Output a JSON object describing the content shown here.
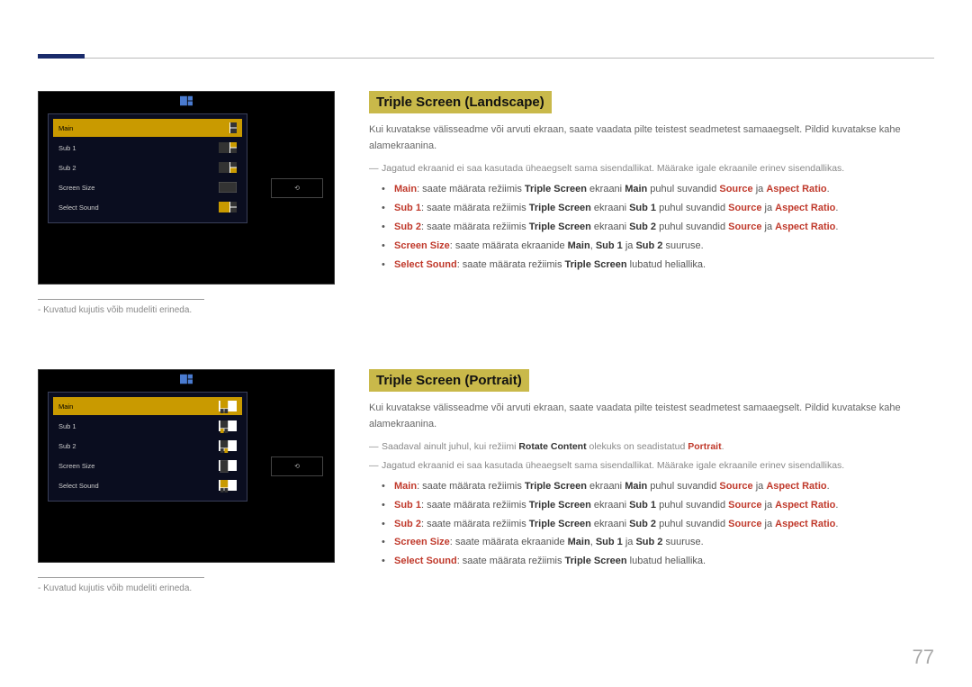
{
  "page_number": "77",
  "caption": "Kuvatud kujutis võib mudeliti erineda.",
  "mock_side_label": "⟲",
  "sections": [
    {
      "title": "Triple Screen (Landscape)",
      "desc": "Kui kuvatakse välisseadme või arvuti ekraan, saate vaadata pilte teistest seadmetest samaaegselt. Pildid kuvatakse kahe alamekraanina.",
      "notes": [
        "Jagatud ekraanid ei saa kasutada üheaegselt sama sisendallikat. Määrake igale ekraanile erinev sisendallikas."
      ],
      "bullets": [
        {
          "lead": "Main",
          "t1": ": saate määrata režiimis ",
          "b1": "Triple Screen",
          "t2": " ekraani ",
          "b2": "Main",
          "t3": " puhul suvandid ",
          "r1": "Source",
          "t4": " ja ",
          "r2": "Aspect Ratio",
          "t5": "."
        },
        {
          "lead": "Sub 1",
          "t1": ": saate määrata režiimis ",
          "b1": "Triple Screen",
          "t2": " ekraani ",
          "b2": "Sub 1",
          "t3": " puhul suvandid ",
          "r1": "Source",
          "t4": " ja ",
          "r2": "Aspect Ratio",
          "t5": "."
        },
        {
          "lead": "Sub 2",
          "t1": ": saate määrata režiimis ",
          "b1": "Triple Screen",
          "t2": " ekraani ",
          "b2": "Sub 2",
          "t3": " puhul suvandid ",
          "r1": "Source",
          "t4": " ja ",
          "r2": "Aspect Ratio",
          "t5": "."
        },
        {
          "lead": "Screen Size",
          "t1": ": saate määrata ekraanide ",
          "b1": "Main",
          "t2": ", ",
          "b2": "Sub 1",
          "t3": " ja ",
          "b3": "Sub 2",
          "t4": " suuruse."
        },
        {
          "lead": "Select Sound",
          "t1": ": saate määrata režiimis ",
          "b1": "Triple Screen",
          "t2": " lubatud heliallika."
        }
      ]
    },
    {
      "title": "Triple Screen (Portrait)",
      "desc": "Kui kuvatakse välisseadme või arvuti ekraan, saate vaadata pilte teistest seadmetest samaaegselt. Pildid kuvatakse kahe alamekraanina.",
      "notes": [
        {
          "t1": "Saadaval ainult juhul, kui režiimi ",
          "b1": "Rotate Content",
          "t2": " olekuks on seadistatud ",
          "r1": "Portrait",
          "t3": "."
        },
        "Jagatud ekraanid ei saa kasutada üheaegselt sama sisendallikat. Määrake igale ekraanile erinev sisendallikas."
      ],
      "bullets": [
        {
          "lead": "Main",
          "t1": ": saate määrata režiimis ",
          "b1": "Triple Screen",
          "t2": " ekraani ",
          "b2": "Main",
          "t3": " puhul suvandid ",
          "r1": "Source",
          "t4": " ja ",
          "r2": "Aspect Ratio",
          "t5": "."
        },
        {
          "lead": "Sub 1",
          "t1": ": saate määrata režiimis ",
          "b1": "Triple Screen",
          "t2": " ekraani ",
          "b2": "Sub 1",
          "t3": " puhul suvandid ",
          "r1": "Source",
          "t4": " ja ",
          "r2": "Aspect Ratio",
          "t5": "."
        },
        {
          "lead": "Sub 2",
          "t1": ": saate määrata režiimis ",
          "b1": "Triple Screen",
          "t2": " ekraani ",
          "b2": "Sub 2",
          "t3": " puhul suvandid ",
          "r1": "Source",
          "t4": " ja ",
          "r2": "Aspect Ratio",
          "t5": "."
        },
        {
          "lead": "Screen Size",
          "t1": ": saate määrata ekraanide ",
          "b1": "Main",
          "t2": ", ",
          "b2": "Sub 1",
          "t3": " ja ",
          "b3": "Sub 2",
          "t4": " suuruse."
        },
        {
          "lead": "Select Sound",
          "t1": ": saate määrata režiimis ",
          "b1": "Triple Screen",
          "t2": " lubatud heliallika."
        }
      ]
    }
  ],
  "mock_menu": [
    {
      "label": "Main",
      "sel": true
    },
    {
      "label": "Sub 1",
      "sel": false
    },
    {
      "label": "Sub 2",
      "sel": false
    },
    {
      "label": "Screen Size",
      "sel": false
    },
    {
      "label": "Select Sound",
      "sel": false
    }
  ]
}
